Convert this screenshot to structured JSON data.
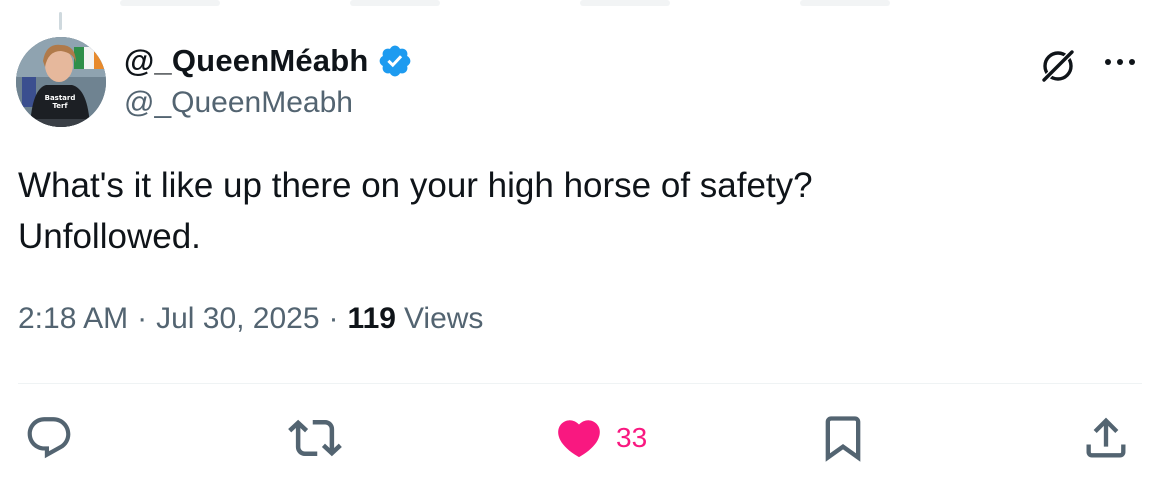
{
  "tweet": {
    "display_name": "@_QueenMéabh",
    "handle": "@_QueenMeabh",
    "text": "What's it like up there on your high horse of safety?\nUnfollowed.",
    "time": "2:18 AM",
    "date": "Jul 30, 2025",
    "views_count": "119",
    "views_label": "Views",
    "separator": "·"
  },
  "avatar": {
    "shirt_text_line1": "Bastard",
    "shirt_text_line2": "Terf"
  },
  "actions": {
    "like_count": "33"
  },
  "colors": {
    "verified": "#1d9bf0",
    "like": "#f91880",
    "secondary_text": "#536471",
    "icon_gray": "#536471"
  },
  "icons": [
    "verified-badge-icon",
    "grok-icon",
    "more-icon",
    "reply-icon",
    "repost-icon",
    "like-icon",
    "bookmark-icon",
    "share-icon"
  ]
}
